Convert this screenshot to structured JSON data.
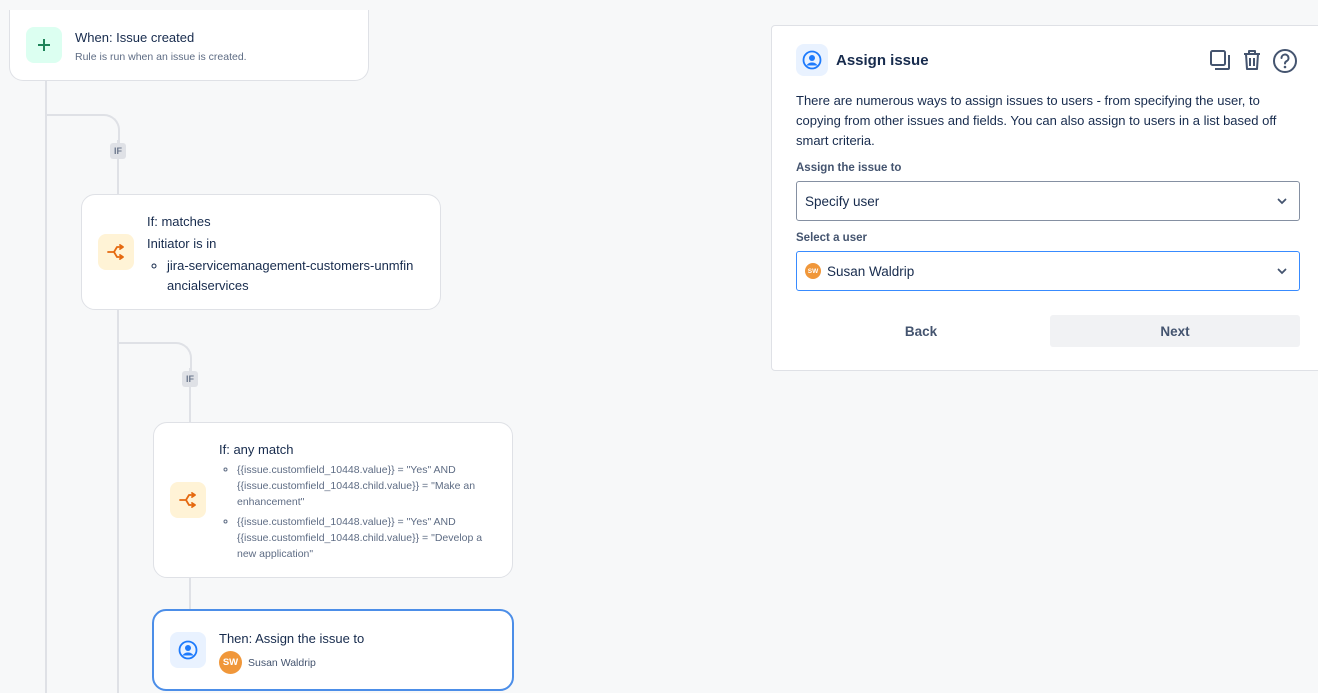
{
  "trigger": {
    "title": "When: Issue created",
    "subtitle": "Rule is run when an issue is created."
  },
  "branch_badge": "IF",
  "condition1": {
    "title": "If: matches",
    "line": "Initiator is in",
    "items": [
      "jira-servicemanagement-customers-unmfinancialservices"
    ]
  },
  "condition2": {
    "title": "If: any match",
    "items": [
      "{{issue.customfield_10448.value}} = \"Yes\" AND {{issue.customfield_10448.child.value}} = \"Make an enhancement\"",
      "{{issue.customfield_10448.value}} = \"Yes\" AND {{issue.customfield_10448.child.value}} = \"Develop a new application\""
    ]
  },
  "action": {
    "title": "Then: Assign the issue to",
    "user_initials": "SW",
    "user_name": "Susan Waldrip"
  },
  "panel": {
    "title": "Assign issue",
    "description": "There are numerous ways to assign issues to users - from specifying the user, to copying from other issues and fields. You can also assign to users in a list based off smart criteria.",
    "assign_label": "Assign the issue to",
    "assign_value": "Specify user",
    "user_label": "Select a user",
    "user_initials": "SW",
    "user_value": "Susan Waldrip",
    "back_label": "Back",
    "next_label": "Next",
    "icons": [
      "duplicate-icon",
      "trash-icon",
      "help-icon"
    ]
  }
}
